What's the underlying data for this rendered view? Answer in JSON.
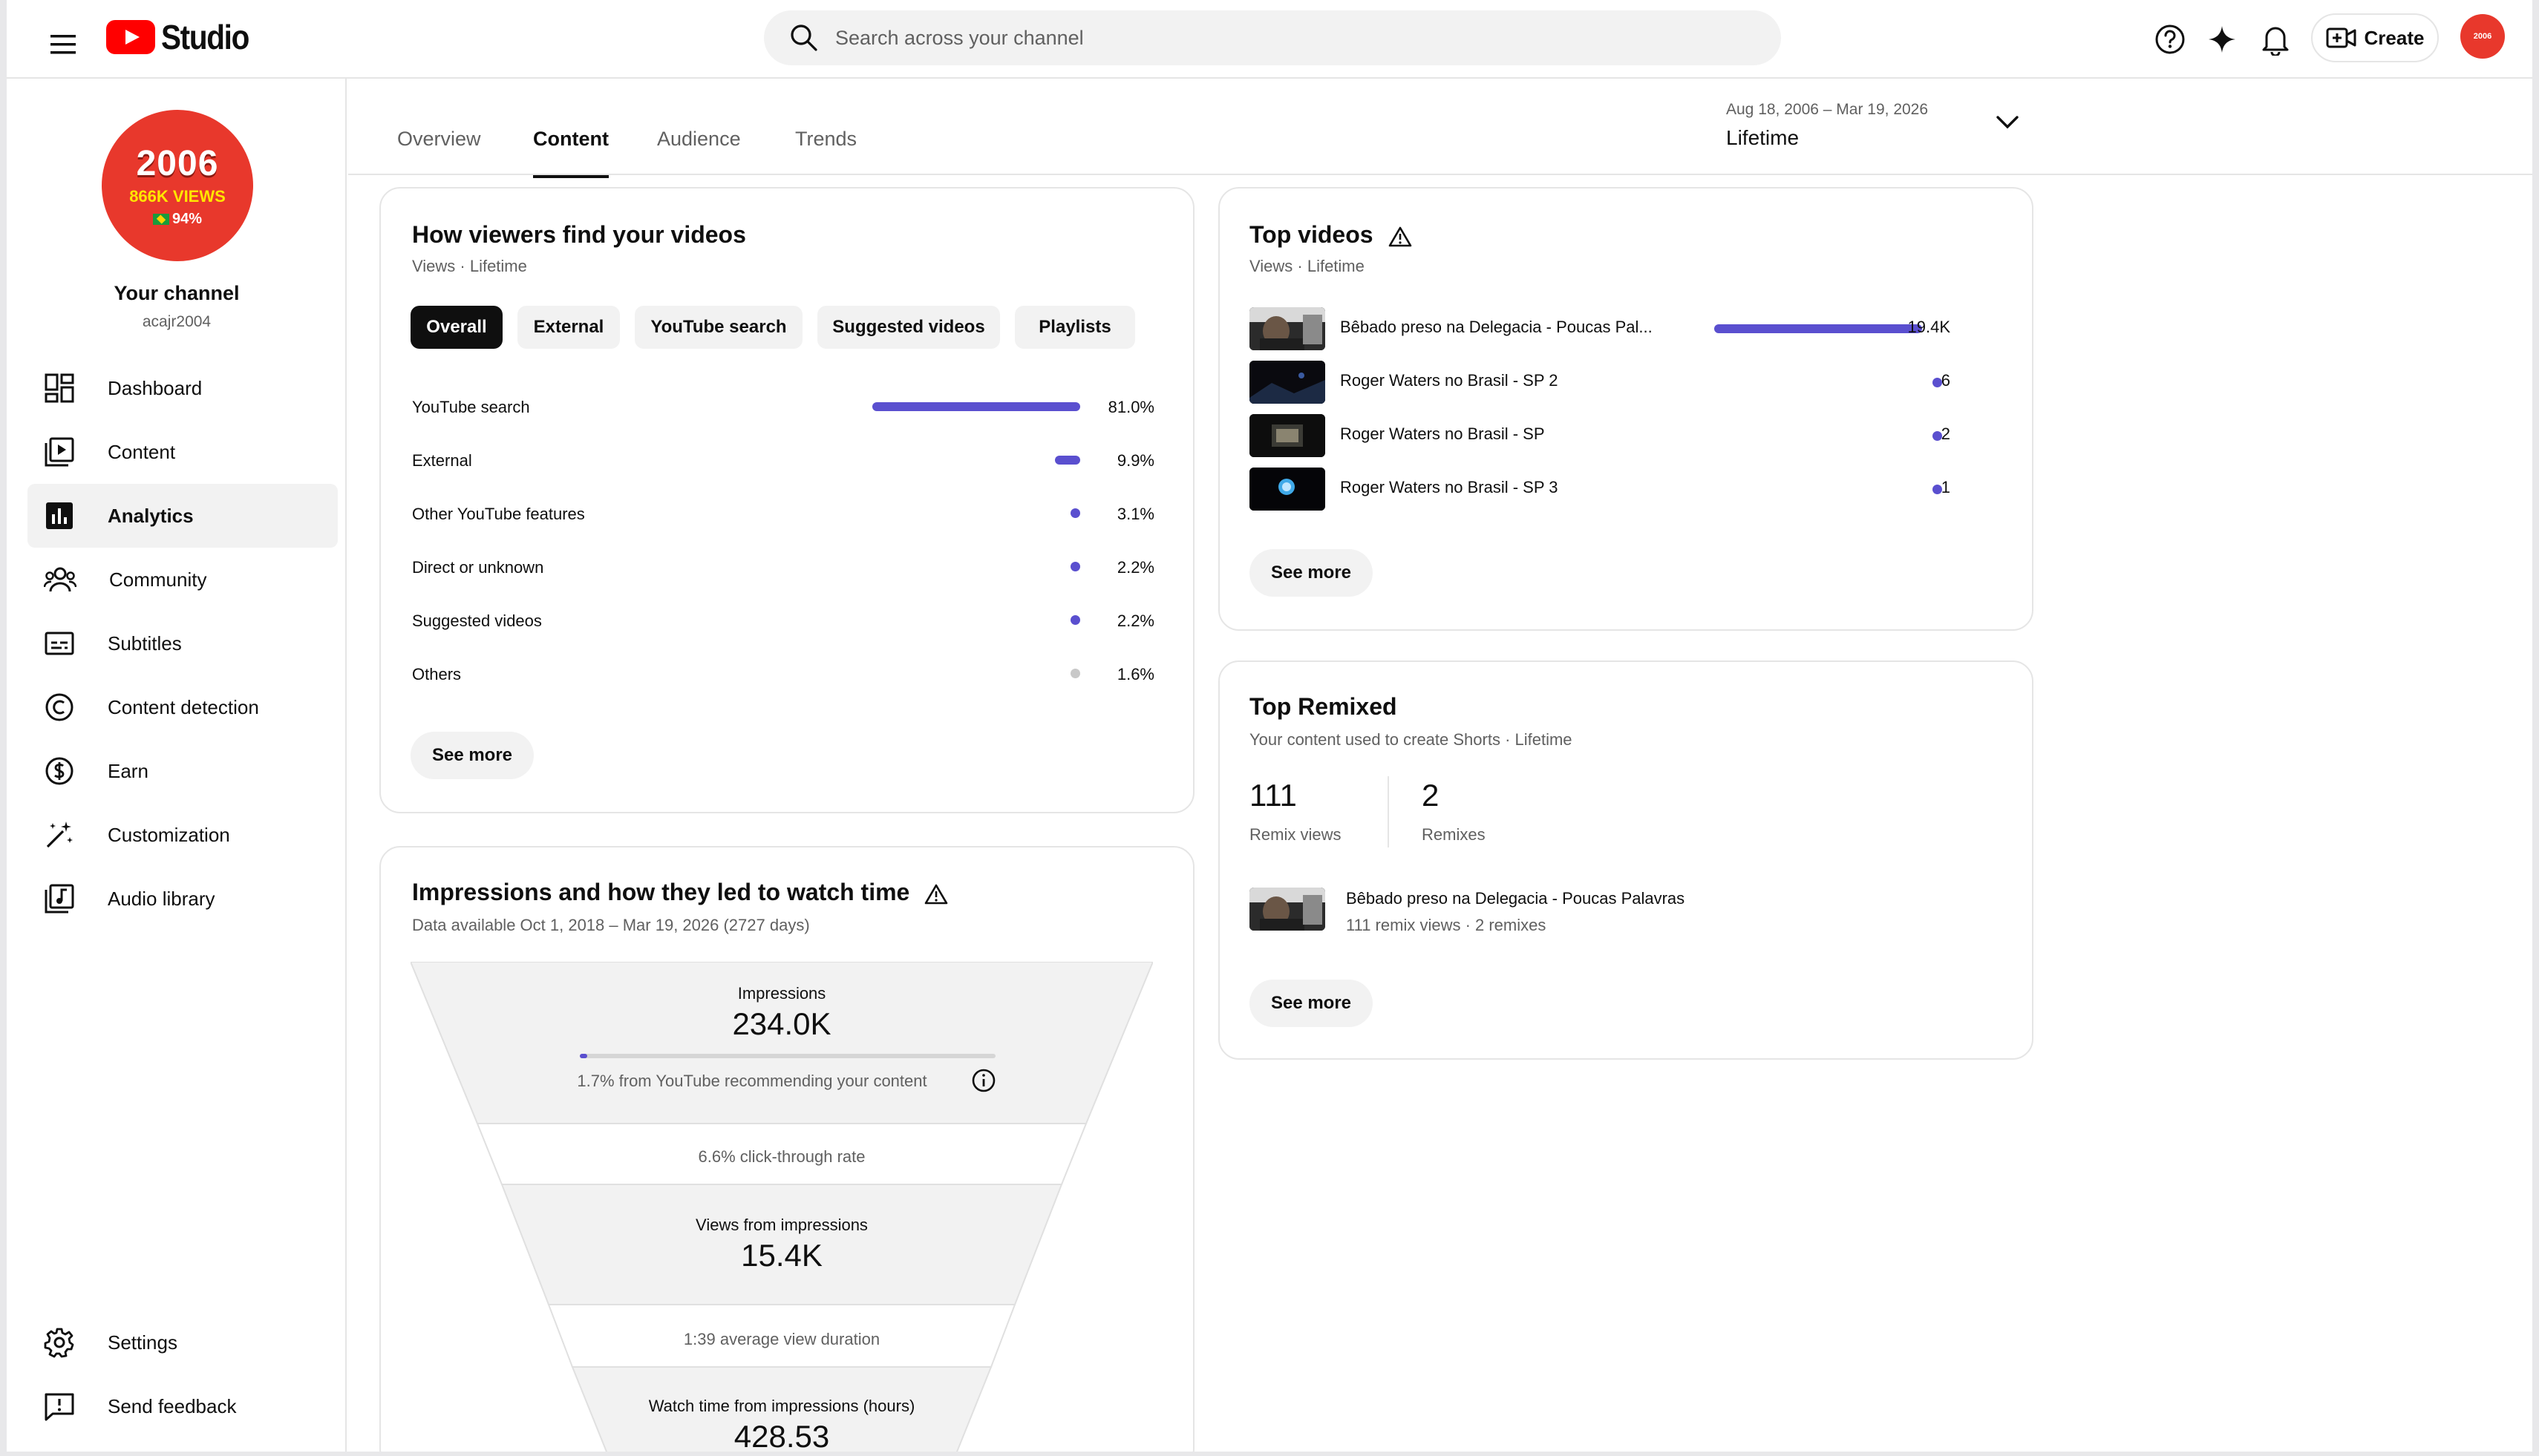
{
  "header": {
    "logo_text": "Studio",
    "search_placeholder": "Search across your channel",
    "create_label": "Create",
    "avatar_text": "2006"
  },
  "sidebar": {
    "channel_avatar": {
      "line1": "2006",
      "line2": "866K VIEWS",
      "line3": "94%"
    },
    "channel_title": "Your channel",
    "channel_handle": "acajr2004",
    "items": [
      {
        "label": "Dashboard",
        "icon": "dashboard-icon"
      },
      {
        "label": "Content",
        "icon": "content-icon"
      },
      {
        "label": "Analytics",
        "icon": "analytics-icon"
      },
      {
        "label": "Community",
        "icon": "community-icon"
      },
      {
        "label": "Subtitles",
        "icon": "subtitles-icon"
      },
      {
        "label": "Content detection",
        "icon": "copyright-icon"
      },
      {
        "label": "Earn",
        "icon": "dollar-icon"
      },
      {
        "label": "Customization",
        "icon": "magic-wand-icon"
      },
      {
        "label": "Audio library",
        "icon": "audio-library-icon"
      }
    ],
    "bottom_items": [
      {
        "label": "Settings",
        "icon": "gear-icon"
      },
      {
        "label": "Send feedback",
        "icon": "feedback-icon"
      }
    ]
  },
  "tabs": [
    "Overview",
    "Content",
    "Audience",
    "Trends"
  ],
  "active_tab": "Content",
  "date_range": {
    "range": "Aug 18, 2006 – Mar 19, 2026",
    "label": "Lifetime"
  },
  "traffic": {
    "title": "How viewers find your videos",
    "subtitle": "Views · Lifetime",
    "chips": [
      "Overall",
      "External",
      "YouTube search",
      "Suggested videos",
      "Playlists"
    ],
    "active_chip": "Overall",
    "rows": [
      {
        "label": "YouTube search",
        "value": "81.0%",
        "share": 0.81
      },
      {
        "label": "External",
        "value": "9.9%",
        "share": 0.099
      },
      {
        "label": "Other YouTube features",
        "value": "3.1%",
        "share": 0.031
      },
      {
        "label": "Direct or unknown",
        "value": "2.2%",
        "share": 0.022
      },
      {
        "label": "Suggested videos",
        "value": "2.2%",
        "share": 0.022
      },
      {
        "label": "Others",
        "value": "1.6%",
        "share": 0.016
      }
    ],
    "see_more": "See more"
  },
  "impressions": {
    "title": "Impressions and how they led to watch time",
    "subtitle": "Data available Oct 1, 2018 – Mar 19, 2026 (2727 days)",
    "impressions_label": "Impressions",
    "impressions_value": "234.0K",
    "recommend_note": "1.7% from YouTube recommending your content",
    "recommend_share": 0.017,
    "ctr_text": "6.6% click-through rate",
    "views_label": "Views from impressions",
    "views_value": "15.4K",
    "avd_text": "1:39 average view duration",
    "watch_label": "Watch time from impressions (hours)",
    "watch_value": "428.53"
  },
  "top_videos": {
    "title": "Top videos",
    "subtitle": "Views · Lifetime",
    "rows": [
      {
        "title": "Bêbado preso na Delegacia - Poucas Pal...",
        "value": "19.4K",
        "share": 1.0
      },
      {
        "title": "Roger Waters no Brasil - SP 2",
        "value": "6",
        "share": 0.0003
      },
      {
        "title": "Roger Waters no Brasil - SP",
        "value": "2",
        "share": 0.0001
      },
      {
        "title": "Roger Waters no Brasil - SP 3",
        "value": "1",
        "share": 5e-05
      }
    ],
    "see_more": "See more"
  },
  "top_remixed": {
    "title": "Top Remixed",
    "subtitle": "Your content used to create Shorts · Lifetime",
    "remix_views_value": "111",
    "remix_views_label": "Remix views",
    "remixes_value": "2",
    "remixes_label": "Remixes",
    "video_title": "Bêbado preso na Delegacia - Poucas Palavras",
    "video_meta": "111 remix views · 2 remixes",
    "see_more": "See more"
  },
  "colors": {
    "accent": "#5a4fcf",
    "brand_red": "#ff0000",
    "avatar_red": "#e8382c"
  }
}
